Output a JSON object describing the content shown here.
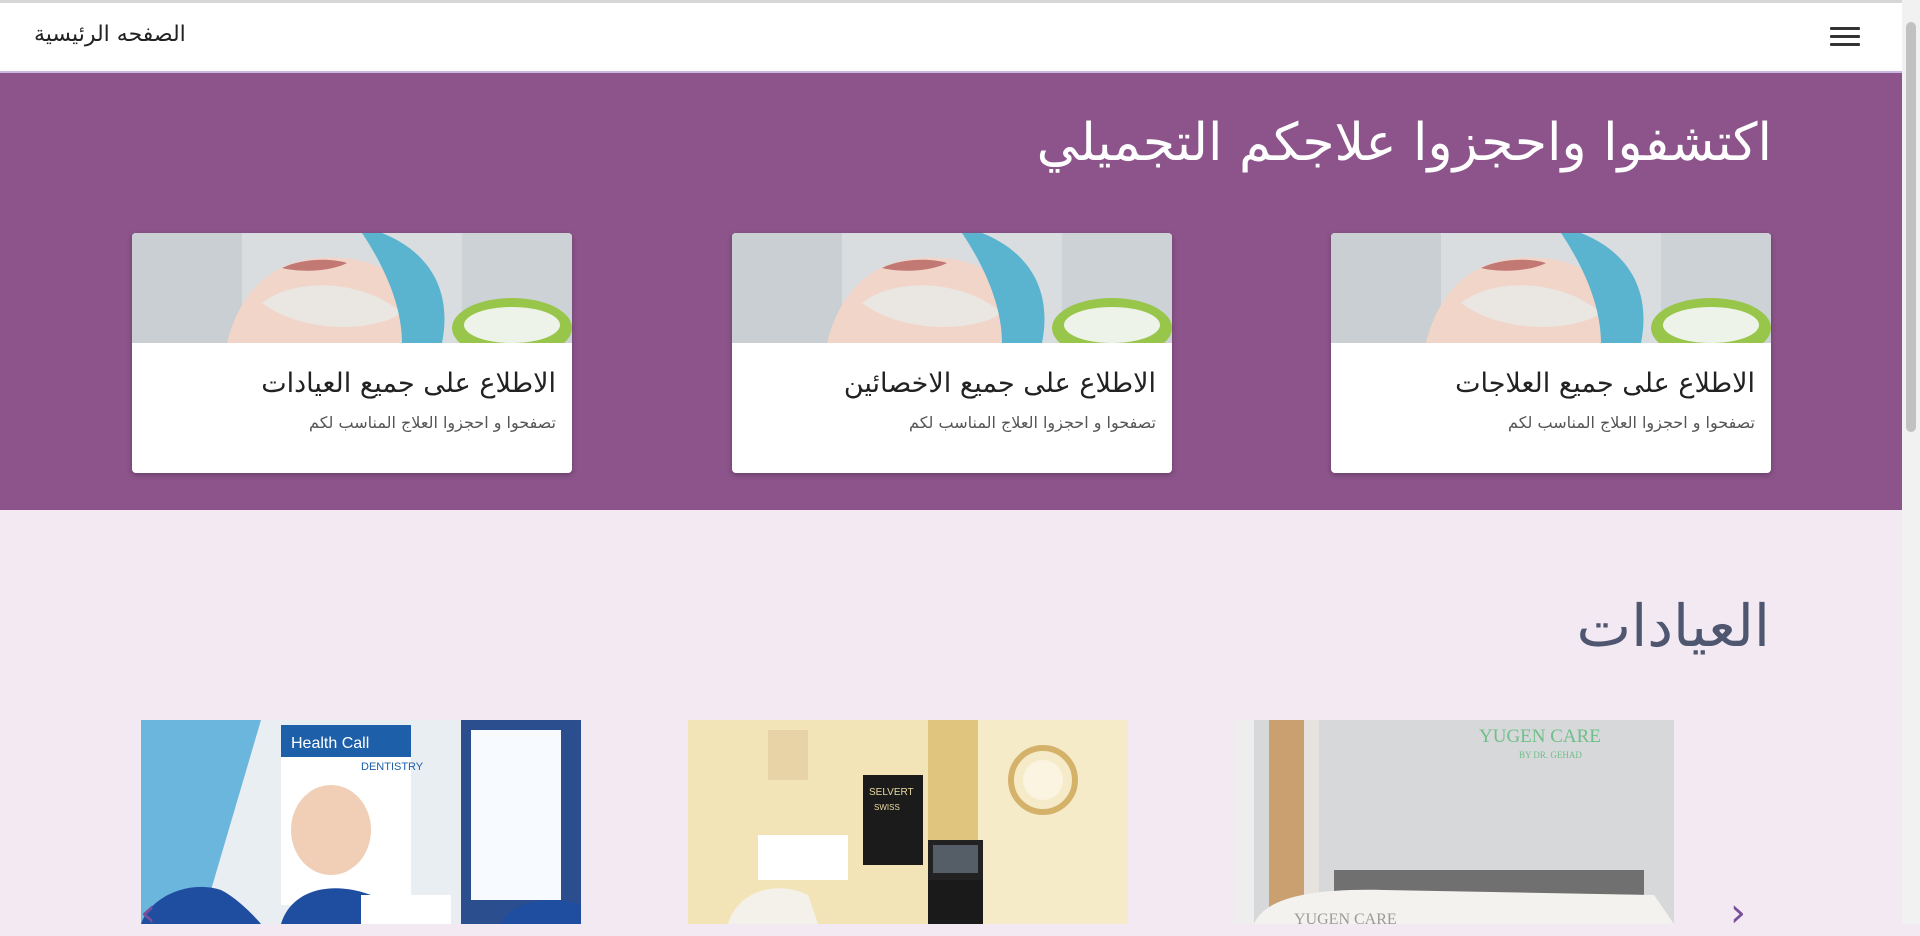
{
  "navbar": {
    "title": "الصفحه الرئيسية",
    "menu_icon": "hamburger-menu-icon"
  },
  "hero": {
    "title": "اكتشفوا واحجزوا علاجكم التجميلي",
    "background": "#8c548b",
    "cards": [
      {
        "title": "الاطلاع على جميع العلاجات",
        "text": "تصفحوا و احجزوا العلاج المناسب لكم"
      },
      {
        "title": "الاطلاع على جميع الاخصائين",
        "text": "تصفحوا و احجزوا العلاج المناسب لكم"
      },
      {
        "title": "الاطلاع على جميع العيادات",
        "text": "تصفحوا و احجزوا العلاج المناسب لكم"
      }
    ]
  },
  "clinics": {
    "title": "العيادات",
    "items": [
      {
        "image_text": "YUGEN CARE",
        "image_subtext": "BY DR. GEHAD",
        "image_bottom_text": "YUGEN CARE"
      },
      {
        "image_text": "SELVERT",
        "image_subtext": "SWISS"
      },
      {
        "image_text": "Health Call",
        "image_subtext": "DENTISTRY"
      }
    ],
    "prev_icon": "chevron-left-icon",
    "next_icon": "chevron-right-icon"
  },
  "colors": {
    "page_bg": "#f3e9f3",
    "title_text": "#4f5670",
    "accent": "#7a4f9a"
  }
}
